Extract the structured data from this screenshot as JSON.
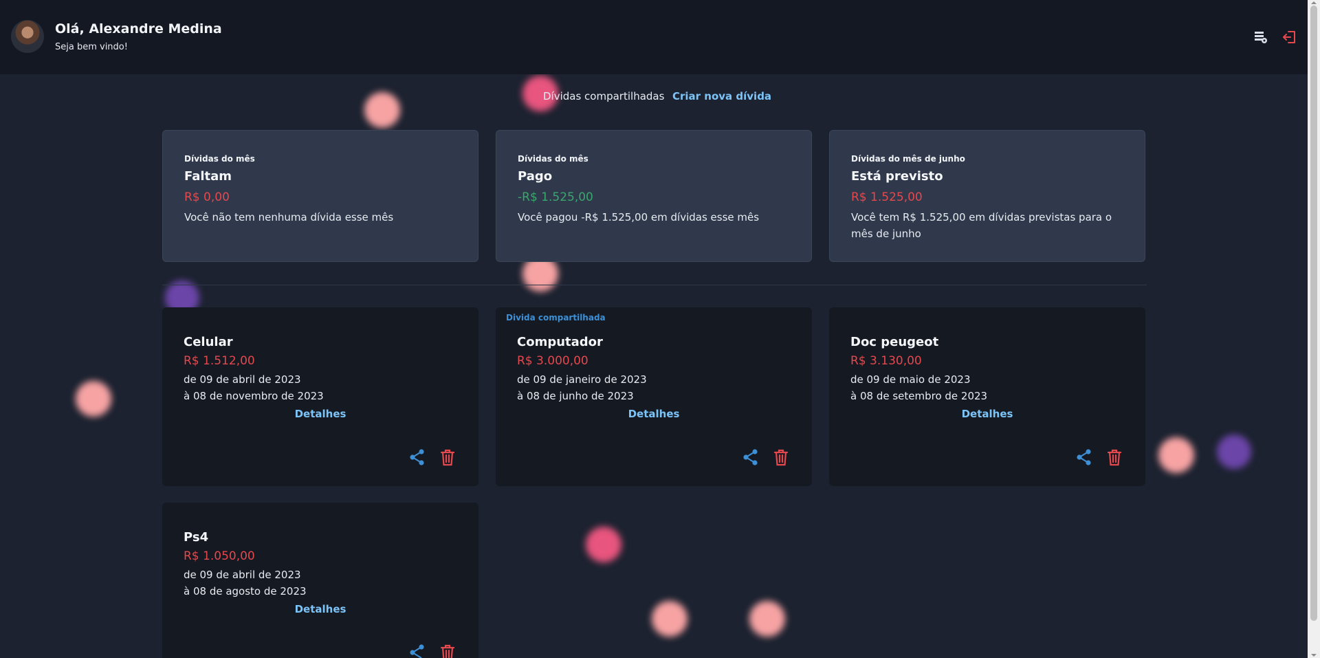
{
  "header": {
    "greeting": "Olá, Alexandre Medina",
    "welcome": "Seja bem vindo!",
    "icons": [
      "table-settings-icon",
      "logout-icon"
    ]
  },
  "nav": {
    "shared_label": "Dívidas compartilhadas",
    "create_label": "Criar nova dívida"
  },
  "summary": [
    {
      "label": "Dívidas do mês",
      "title": "Faltam",
      "amount": "R$ 0,00",
      "amount_color": "#e5484d",
      "description": "Você não tem nenhuma dívida esse mês"
    },
    {
      "label": "Dívidas do mês",
      "title": "Pago",
      "amount": "-R$ 1.525,00",
      "amount_color": "#3aa76d",
      "description": "Você pagou -R$ 1.525,00 em dívidas esse mês"
    },
    {
      "label": "Dívidas do mês de junho",
      "title": "Está previsto",
      "amount": "R$ 1.525,00",
      "amount_color": "#e5484d",
      "description": "Você tem R$ 1.525,00 em dívidas previstas para o mês de junho"
    }
  ],
  "debts": [
    {
      "tag": "",
      "name": "Celular",
      "amount": "R$ 1.512,00",
      "from": "de 09 de abril de 2023",
      "to": "à 08 de novembro de 2023",
      "details": "Detalhes"
    },
    {
      "tag": "Divida compartilhada",
      "name": "Computador",
      "amount": "R$ 3.000,00",
      "from": "de 09 de janeiro de 2023",
      "to": "à 08 de junho de 2023",
      "details": "Detalhes"
    },
    {
      "tag": "",
      "name": "Doc peugeot",
      "amount": "R$ 3.130,00",
      "from": "de 09 de maio de 2023",
      "to": "à 08 de setembro de 2023",
      "details": "Detalhes"
    },
    {
      "tag": "",
      "name": "Ps4",
      "amount": "R$ 1.050,00",
      "from": "de 09 de abril de 2023",
      "to": "à 08 de agosto de 2023",
      "details": "Detalhes"
    }
  ],
  "colors": {
    "background": "#1c2230",
    "header_bg": "#141822",
    "summary_card_bg": "#2f394b",
    "debt_card_bg": "#151922",
    "link": "#7cc4f8",
    "share_icon": "#3d8fd6",
    "trash_icon": "#e5484d"
  }
}
